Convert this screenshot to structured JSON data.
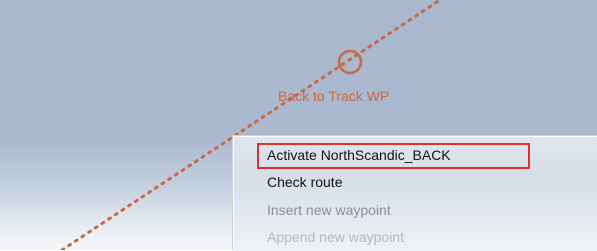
{
  "map": {
    "waypoint_label": "Back to Track WP",
    "route_color": "#c9693f"
  },
  "context_menu": {
    "items": [
      {
        "label": "Activate NorthScandic_BACK",
        "enabled": true,
        "highlighted": true
      },
      {
        "label": "Check route",
        "enabled": true
      },
      {
        "label": "Insert new waypoint",
        "enabled": false
      },
      {
        "label": "Append new waypoint",
        "enabled": false
      }
    ],
    "highlight_color": "#e0312a"
  }
}
